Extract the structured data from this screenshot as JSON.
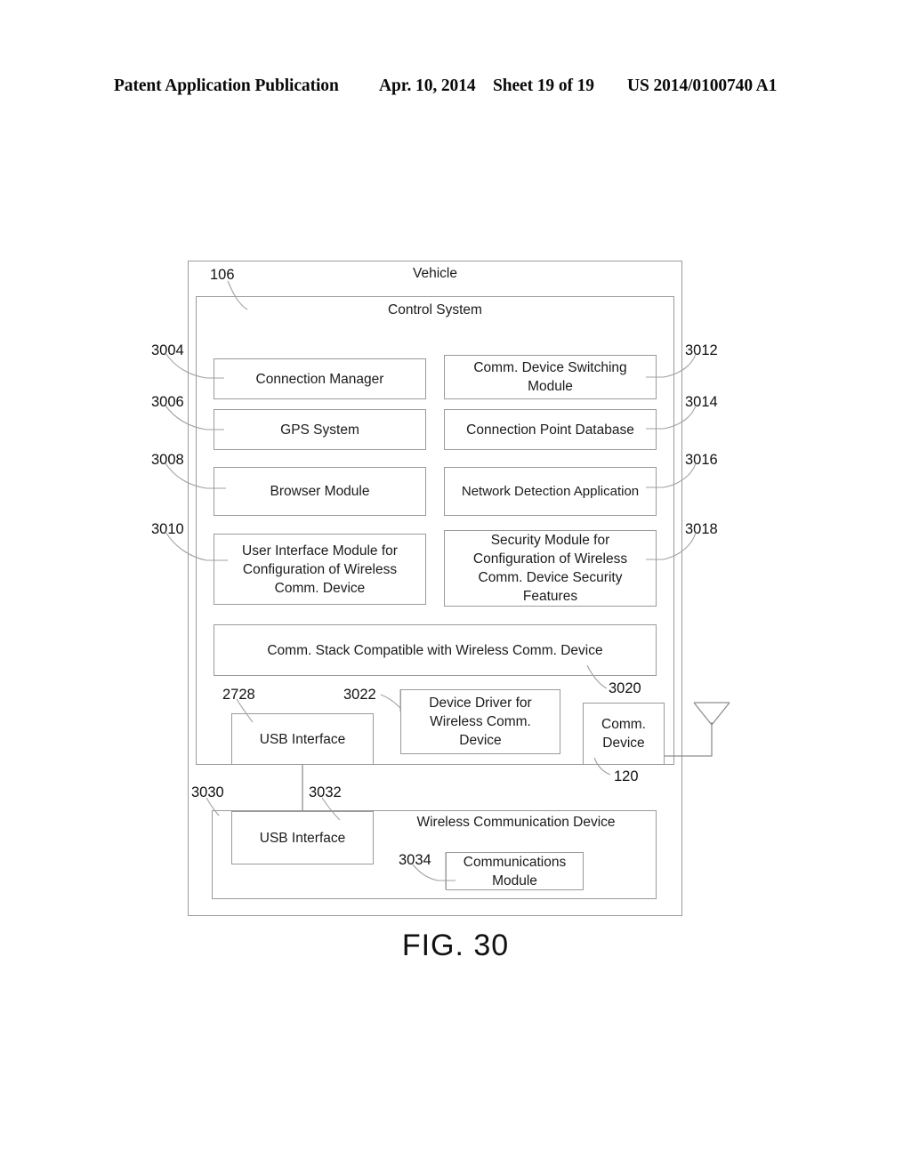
{
  "header": {
    "publication": "Patent Application Publication",
    "date": "Apr. 10, 2014",
    "sheet": "Sheet 19 of 19",
    "number": "US 2014/0100740 A1"
  },
  "figure": {
    "caption": "FIG. 30"
  },
  "diagram": {
    "vehicle_title": "Vehicle",
    "vehicle_ref": "106",
    "control_system_title": "Control System",
    "modules": [
      {
        "ref": "3004",
        "label": "Connection Manager"
      },
      {
        "ref": "3006",
        "label": "GPS System"
      },
      {
        "ref": "3008",
        "label": "Browser Module"
      },
      {
        "ref": "3010",
        "label": "User Interface Module for\nConfiguration of Wireless\nComm. Device"
      },
      {
        "ref": "3012",
        "label": "Comm. Device Switching\nModule"
      },
      {
        "ref": "3014",
        "label": "Connection Point Database"
      },
      {
        "ref": "3016",
        "label": "Network Detection Application"
      },
      {
        "ref": "3018",
        "label": "Security Module for\nConfiguration of Wireless\nComm. Device Security\nFeatures"
      }
    ],
    "comm_stack": {
      "ref": "3020",
      "label": "Comm. Stack Compatible with Wireless Comm. Device"
    },
    "usb_interface_top": {
      "ref": "2728",
      "label": "USB Interface"
    },
    "device_driver": {
      "ref": "3022",
      "label": "Device Driver for\nWireless Comm.\nDevice"
    },
    "comm_device": {
      "ref": "120",
      "label": "Comm.\nDevice"
    },
    "antenna": {
      "name": "antenna-symbol"
    },
    "wireless_comm_device": {
      "ref": "3030",
      "title": "Wireless Communication Device",
      "usb_interface": {
        "ref": "3032",
        "label": "USB Interface"
      },
      "communications_module": {
        "ref": "3034",
        "label": "Communications\nModule"
      }
    }
  },
  "colors": {
    "ink": "#111111",
    "line": "#9a9a9a",
    "background": "#ffffff"
  }
}
